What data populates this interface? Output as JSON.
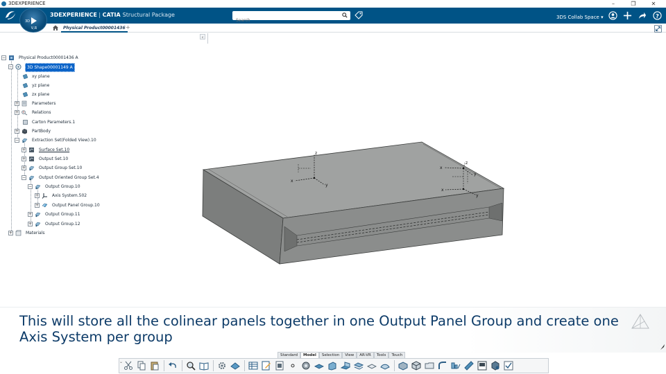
{
  "window": {
    "title": "3DEXPERIENCE",
    "controls": [
      "–",
      "❐",
      "✕"
    ]
  },
  "topbar": {
    "brand_main": "3DEXPERIENCE",
    "brand_sep": " | ",
    "brand_app": "CATIA",
    "brand_package": "Structural Package",
    "compass_version": "V,R",
    "compass_num": "3D",
    "search_placeholder": "Search",
    "collab_space": "3DS Collab Space"
  },
  "tabs": {
    "active_label": "Physical Product00001436",
    "add_label": "+"
  },
  "tree": {
    "collapse_label": "‹",
    "nodes": [
      {
        "label": "Physical Product00001436 A",
        "icon": "product-icon"
      },
      {
        "label": "3D Shape00001149 A",
        "icon": "shape-icon"
      },
      {
        "label": "xy plane",
        "icon": "plane-icon"
      },
      {
        "label": "yz plane",
        "icon": "plane-icon"
      },
      {
        "label": "zx plane",
        "icon": "plane-icon"
      },
      {
        "label": "Parameters",
        "icon": "parameters-icon"
      },
      {
        "label": "Relations",
        "icon": "relations-icon"
      },
      {
        "label": "Carton Parameters.1",
        "icon": "carton-parameters-icon"
      },
      {
        "label": "PartBody",
        "icon": "partbody-icon"
      },
      {
        "label": "Extraction Set(Folded View).10",
        "icon": "extraction-set-icon"
      },
      {
        "label": "Surface Set.10",
        "icon": "surface-set-icon"
      },
      {
        "label": "Output Set.10",
        "icon": "output-set-icon"
      },
      {
        "label": "Output Group Set.10",
        "icon": "output-group-set-icon"
      },
      {
        "label": "Output Oriented Group Set.4",
        "icon": "oriented-group-set-icon"
      },
      {
        "label": "Output Group.10",
        "icon": "output-group-icon"
      },
      {
        "label": "Axis System.502",
        "icon": "axis-system-icon"
      },
      {
        "label": "Output Panel Group.10",
        "icon": "output-panel-group-icon"
      },
      {
        "label": "Output Group.11",
        "icon": "output-group-icon"
      },
      {
        "label": "Output Group.12",
        "icon": "output-group-icon"
      },
      {
        "label": "Materials",
        "icon": "materials-icon"
      }
    ]
  },
  "viewport": {
    "axis_labels": {
      "z1": "z",
      "x1": "x",
      "y1": "y",
      "z2": "z",
      "x2": "x",
      "y2": "y",
      "x3": "x",
      "y3": "y"
    }
  },
  "caption": {
    "text": "This will store all the colinear panels together in one Output Panel Group and create one Axis System per group"
  },
  "section_tabs": [
    "Standard",
    "Model",
    "Selection",
    "View",
    "AR-VR",
    "Tools",
    "Touch"
  ],
  "active_section": "Model",
  "colors": {
    "topbar": "#005386",
    "caption_text": "#0d3b68",
    "selection": "#0a63c8",
    "model_face": "#8f9190"
  }
}
